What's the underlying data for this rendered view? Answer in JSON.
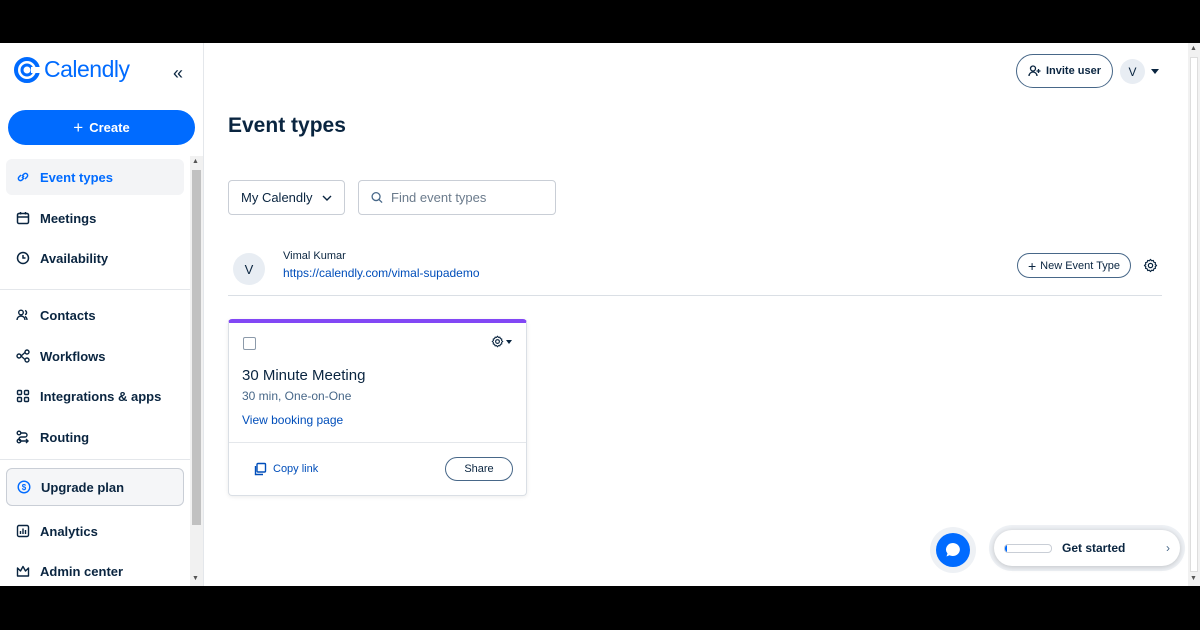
{
  "sidebar": {
    "logo_text": "Calendly",
    "create_label": "Create",
    "items": [
      {
        "label": "Event types",
        "icon": "link-icon"
      },
      {
        "label": "Meetings",
        "icon": "calendar-icon"
      },
      {
        "label": "Availability",
        "icon": "clock-icon"
      },
      {
        "label": "Contacts",
        "icon": "contacts-icon"
      },
      {
        "label": "Workflows",
        "icon": "workflow-icon"
      },
      {
        "label": "Integrations & apps",
        "icon": "apps-grid-icon"
      },
      {
        "label": "Routing",
        "icon": "routing-icon"
      },
      {
        "label": "Upgrade plan",
        "icon": "dollar-circle-icon"
      },
      {
        "label": "Analytics",
        "icon": "chart-icon"
      },
      {
        "label": "Admin center",
        "icon": "crown-icon"
      }
    ]
  },
  "header": {
    "invite_label": "Invite user",
    "avatar_initial": "V"
  },
  "main": {
    "title": "Event types",
    "select_value": "My Calendly",
    "search_placeholder": "Find event types",
    "user": {
      "initial": "V",
      "name": "Vimal Kumar",
      "url": "https://calendly.com/vimal-supademo"
    },
    "new_event_label": "New Event Type",
    "card": {
      "title": "30 Minute Meeting",
      "subtitle": "30 min, One-on-One",
      "link_label": "View booking page",
      "copy_label": "Copy link",
      "share_label": "Share",
      "accent_color": "#8247f5"
    }
  },
  "widget": {
    "get_started_label": "Get started",
    "progress": 0.05
  },
  "colors": {
    "brand": "#006bff",
    "text": "#0a2540",
    "link": "#004eba"
  }
}
